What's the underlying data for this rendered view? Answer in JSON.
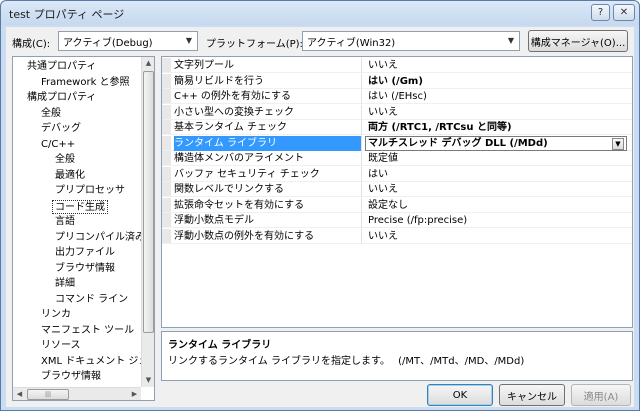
{
  "window": {
    "title": "test プロパティ ページ",
    "help_glyph": "?",
    "close_glyph": "✕"
  },
  "toolbar": {
    "config_label": "構成(C):",
    "config_value": "アクティブ(Debug)",
    "platform_label": "プラットフォーム(P):",
    "platform_value": "アクティブ(Win32)",
    "config_manager_label": "構成マネージャ(O)..."
  },
  "tree": {
    "items": [
      {
        "label": "共通プロパティ",
        "level": 0
      },
      {
        "label": "Framework と参照",
        "level": 1
      },
      {
        "label": "構成プロパティ",
        "level": 0
      },
      {
        "label": "全般",
        "level": 1
      },
      {
        "label": "デバッグ",
        "level": 1
      },
      {
        "label": "C/C++",
        "level": 1
      },
      {
        "label": "全般",
        "level": 2
      },
      {
        "label": "最適化",
        "level": 2
      },
      {
        "label": "プリプロセッサ",
        "level": 2
      },
      {
        "label": "コード生成",
        "level": 2,
        "selected": true
      },
      {
        "label": "言語",
        "level": 2
      },
      {
        "label": "プリコンパイル済み",
        "level": 2
      },
      {
        "label": "出力ファイル",
        "level": 2
      },
      {
        "label": "ブラウザ情報",
        "level": 2
      },
      {
        "label": "詳細",
        "level": 2
      },
      {
        "label": "コマンド ライン",
        "level": 2
      },
      {
        "label": "リンカ",
        "level": 1
      },
      {
        "label": "マニフェスト ツール",
        "level": 1
      },
      {
        "label": "リソース",
        "level": 1
      },
      {
        "label": "XML ドキュメント ジェ",
        "level": 1
      },
      {
        "label": "ブラウザ情報",
        "level": 1
      }
    ],
    "hscroll_grip": "|||"
  },
  "properties": [
    {
      "name": "文字列プール",
      "value": "いいえ",
      "bold": false
    },
    {
      "name": "簡易リビルドを行う",
      "value": "はい (/Gm)",
      "bold": true
    },
    {
      "name": "C++ の例外を有効にする",
      "value": "はい (/EHsc)",
      "bold": false
    },
    {
      "name": "小さい型への変換チェック",
      "value": "いいえ",
      "bold": false
    },
    {
      "name": "基本ランタイム チェック",
      "value": "両方 (/RTC1, /RTCsu と同等)",
      "bold": true
    },
    {
      "name": "ランタイム ライブラリ",
      "value": "マルチスレッド デバッグ DLL (/MDd)",
      "bold": true,
      "selected": true
    },
    {
      "name": "構造体メンバのアライメント",
      "value": "既定値",
      "bold": false
    },
    {
      "name": "バッファ セキュリティ チェック",
      "value": "はい",
      "bold": false
    },
    {
      "name": "関数レベルでリンクする",
      "value": "いいえ",
      "bold": false
    },
    {
      "name": "拡張命令セットを有効にする",
      "value": "設定なし",
      "bold": false
    },
    {
      "name": "浮動小数点モデル",
      "value": "Precise (/fp:precise)",
      "bold": false
    },
    {
      "name": "浮動小数点の例外を有効にする",
      "value": "いいえ",
      "bold": false
    }
  ],
  "description": {
    "title": "ランタイム ライブラリ",
    "text": "リンクするランタイム ライブラリを指定します。　 (/MT、/MTd、/MD、/MDd)"
  },
  "buttons": {
    "ok": "OK",
    "cancel": "キャンセル",
    "apply": "適用(A)"
  }
}
